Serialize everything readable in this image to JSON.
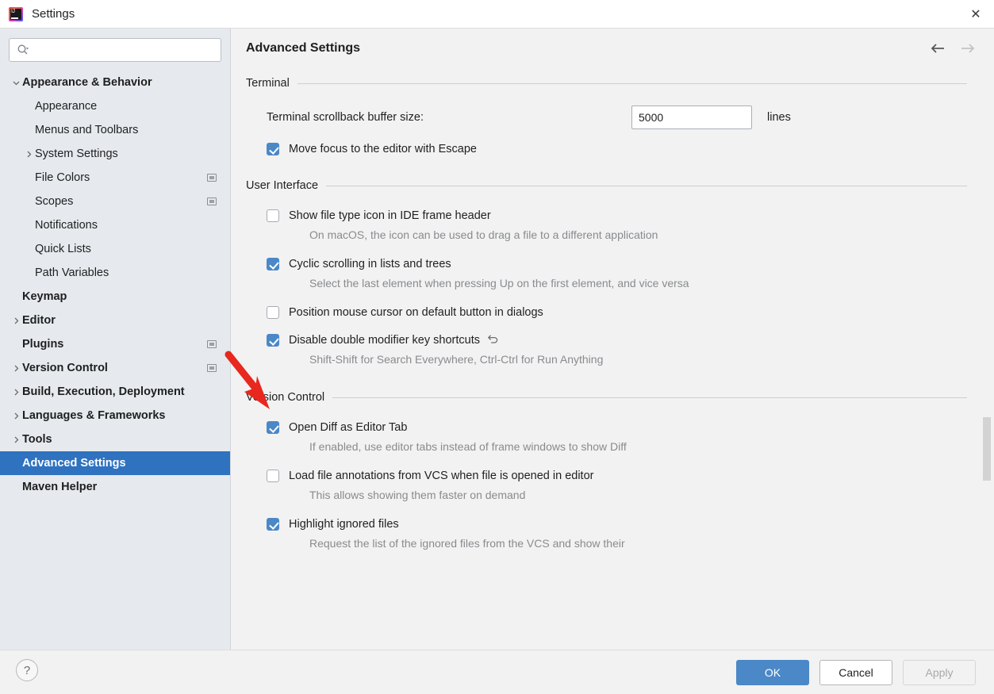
{
  "window": {
    "title": "Settings",
    "app_icon": "intellij-idea-icon",
    "close_label": "✕"
  },
  "sidebar": {
    "search": {
      "placeholder": "",
      "value": "",
      "icon": "search-icon"
    },
    "items": [
      {
        "label": "Appearance & Behavior",
        "indent": 1,
        "arrow": "down",
        "bold": true,
        "selected": false,
        "icon": null
      },
      {
        "label": "Appearance",
        "indent": 2,
        "arrow": "none",
        "bold": false,
        "selected": false,
        "icon": null
      },
      {
        "label": "Menus and Toolbars",
        "indent": 2,
        "arrow": "none",
        "bold": false,
        "selected": false,
        "icon": null
      },
      {
        "label": "System Settings",
        "indent": 2,
        "arrow": "right",
        "bold": false,
        "selected": false,
        "icon": null
      },
      {
        "label": "File Colors",
        "indent": 2,
        "arrow": "none",
        "bold": false,
        "selected": false,
        "icon": "screen-icon"
      },
      {
        "label": "Scopes",
        "indent": 2,
        "arrow": "none",
        "bold": false,
        "selected": false,
        "icon": "screen-icon"
      },
      {
        "label": "Notifications",
        "indent": 2,
        "arrow": "none",
        "bold": false,
        "selected": false,
        "icon": null
      },
      {
        "label": "Quick Lists",
        "indent": 2,
        "arrow": "none",
        "bold": false,
        "selected": false,
        "icon": null
      },
      {
        "label": "Path Variables",
        "indent": 2,
        "arrow": "none",
        "bold": false,
        "selected": false,
        "icon": null
      },
      {
        "label": "Keymap",
        "indent": 1,
        "arrow": "none",
        "bold": true,
        "selected": false,
        "icon": null
      },
      {
        "label": "Editor",
        "indent": 1,
        "arrow": "right",
        "bold": true,
        "selected": false,
        "icon": null
      },
      {
        "label": "Plugins",
        "indent": 1,
        "arrow": "none",
        "bold": true,
        "selected": false,
        "icon": "screen-icon"
      },
      {
        "label": "Version Control",
        "indent": 1,
        "arrow": "right",
        "bold": true,
        "selected": false,
        "icon": "screen-icon"
      },
      {
        "label": "Build, Execution, Deployment",
        "indent": 1,
        "arrow": "right",
        "bold": true,
        "selected": false,
        "icon": null
      },
      {
        "label": "Languages & Frameworks",
        "indent": 1,
        "arrow": "right",
        "bold": true,
        "selected": false,
        "icon": null
      },
      {
        "label": "Tools",
        "indent": 1,
        "arrow": "right",
        "bold": true,
        "selected": false,
        "icon": null
      },
      {
        "label": "Advanced Settings",
        "indent": 1,
        "arrow": "none",
        "bold": true,
        "selected": true,
        "icon": null
      },
      {
        "label": "Maven Helper",
        "indent": 1,
        "arrow": "none",
        "bold": true,
        "selected": false,
        "icon": null
      }
    ]
  },
  "main": {
    "title": "Advanced Settings",
    "nav": {
      "back": "back-arrow",
      "back_enabled": true,
      "forward": "forward-arrow",
      "forward_enabled": false
    },
    "groups": [
      {
        "title": "Terminal",
        "field": {
          "label": "Terminal scrollback buffer size:",
          "value": "5000",
          "unit": "lines"
        },
        "options": [
          {
            "label": "Move focus to the editor with Escape",
            "checked": true,
            "desc": null,
            "revert": false
          }
        ]
      },
      {
        "title": "User Interface",
        "options": [
          {
            "label": "Show file type icon in IDE frame header",
            "checked": false,
            "desc": "On macOS, the icon can be used to drag a file to a different application",
            "revert": false
          },
          {
            "label": "Cyclic scrolling in lists and trees",
            "checked": true,
            "desc": "Select the last element when pressing Up on the first element, and vice versa",
            "revert": false
          },
          {
            "label": "Position mouse cursor on default button in dialogs",
            "checked": false,
            "desc": null,
            "revert": false
          },
          {
            "label": "Disable double modifier key shortcuts",
            "checked": true,
            "desc": "Shift-Shift for Search Everywhere, Ctrl-Ctrl for Run Anything",
            "revert": true
          }
        ]
      },
      {
        "title": "Version Control",
        "options": [
          {
            "label": "Open Diff as Editor Tab",
            "checked": true,
            "desc": "If enabled, use editor tabs instead of frame windows to show Diff",
            "revert": false
          },
          {
            "label": "Load file annotations from VCS when file is opened in editor",
            "checked": false,
            "desc": "This allows showing them faster on demand",
            "revert": false
          },
          {
            "label": "Highlight ignored files",
            "checked": true,
            "desc": "Request the list of the ignored files from the VCS and show their",
            "revert": false
          }
        ]
      }
    ]
  },
  "footer": {
    "help_label": "?",
    "ok_label": "OK",
    "cancel_label": "Cancel",
    "apply_label": "Apply",
    "apply_enabled": false
  },
  "annotation": {
    "type": "red-arrow",
    "color": "#e8271f",
    "points_to": "Disable double modifier key shortcuts"
  },
  "colors": {
    "accent": "#4a88c7",
    "selection": "#2f72bf",
    "sidebar_bg": "#e6eaee",
    "content_bg": "#f2f2f2",
    "muted_text": "#888b8e",
    "annotation_red": "#e8271f"
  }
}
